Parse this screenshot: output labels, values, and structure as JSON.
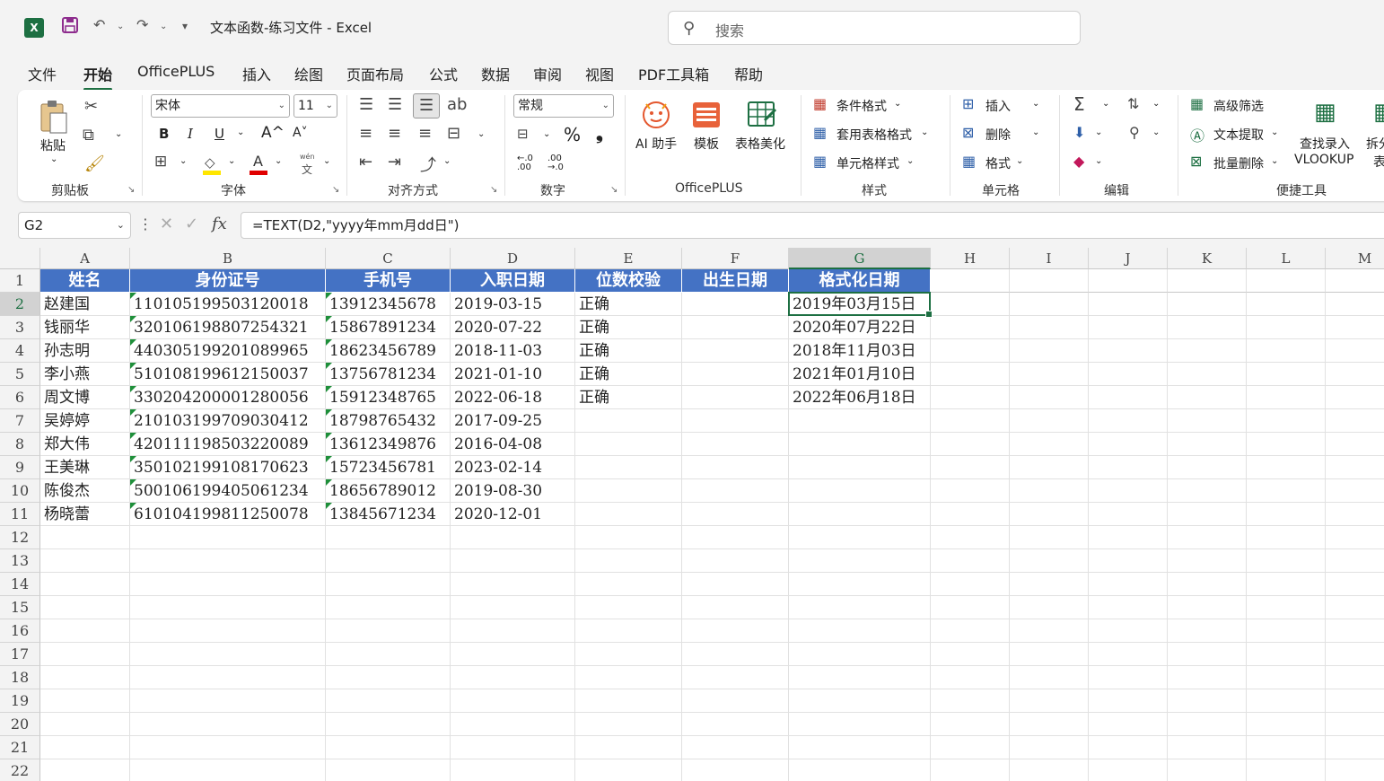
{
  "titlebar": {
    "app_icon": "excel-icon",
    "doc_title": "文本函数-练习文件  -  Excel",
    "search_placeholder": "搜索"
  },
  "tabs": [
    "文件",
    "开始",
    "OfficePLUS",
    "插入",
    "绘图",
    "页面布局",
    "公式",
    "数据",
    "审阅",
    "视图",
    "PDF工具箱",
    "帮助"
  ],
  "active_tab": "开始",
  "ribbon": {
    "clipboard": {
      "paste": "粘贴",
      "label": "剪贴板"
    },
    "font": {
      "name": "宋体",
      "size": "11",
      "label": "字体",
      "bold": "B",
      "italic": "I",
      "underline": "U",
      "grow": "A^",
      "shrink": "A˅",
      "wen": "wén",
      "wen2": "文"
    },
    "alignment": {
      "label": "对齐方式"
    },
    "number": {
      "format": "常规",
      "label": "数字",
      "percent": "%",
      "comma": "❟",
      "inc_dec": "←.0\n.00",
      "dec_dec": ".00\n→.0"
    },
    "officeplus": {
      "ai": "AI 助手",
      "template": "模板",
      "beautify": "表格美化",
      "label": "OfficePLUS"
    },
    "styles": {
      "conditional": "条件格式",
      "table_format": "套用表格格式",
      "cell_styles": "单元格样式",
      "label": "样式"
    },
    "cells": {
      "insert": "插入",
      "delete": "删除",
      "format": "格式",
      "label": "单元格"
    },
    "editing": {
      "label": "编辑"
    },
    "tools": {
      "advanced_filter": "高级筛选",
      "text_extract": "文本提取",
      "batch_delete": "批量删除",
      "lookup_line1": "查找录入",
      "lookup_line2": "VLOOKUP",
      "split1": "拆分",
      "split2": "表",
      "label": "便捷工具"
    }
  },
  "formula_bar": {
    "name_box": "G2",
    "formula": "=TEXT(D2,\"yyyy年mm月dd日\")"
  },
  "sheet": {
    "columns": [
      "A",
      "B",
      "C",
      "D",
      "E",
      "F",
      "G",
      "H",
      "I",
      "J",
      "K",
      "L",
      "M"
    ],
    "header_row": [
      "姓名",
      "身份证号",
      "手机号",
      "入职日期",
      "位数校验",
      "出生日期",
      "格式化日期"
    ],
    "rows": [
      [
        "赵建国",
        "110105199503120018",
        "13912345678",
        "2019-03-15",
        "正确",
        "",
        "2019年03月15日"
      ],
      [
        "钱丽华",
        "320106198807254321",
        "15867891234",
        "2020-07-22",
        "正确",
        "",
        "2020年07月22日"
      ],
      [
        "孙志明",
        "440305199201089965",
        "18623456789",
        "2018-11-03",
        "正确",
        "",
        "2018年11月03日"
      ],
      [
        "李小燕",
        "510108199612150037",
        "13756781234",
        "2021-01-10",
        "正确",
        "",
        "2021年01月10日"
      ],
      [
        "周文博",
        "330204200001280056",
        "15912348765",
        "2022-06-18",
        "正确",
        "",
        "2022年06月18日"
      ],
      [
        "吴婷婷",
        "210103199709030412",
        "18798765432",
        "2017-09-25",
        "",
        "",
        ""
      ],
      [
        "郑大伟",
        "420111198503220089",
        "13612349876",
        "2016-04-08",
        "",
        "",
        ""
      ],
      [
        "王美琳",
        "350102199108170623",
        "15723456781",
        "2023-02-14",
        "",
        "",
        ""
      ],
      [
        "陈俊杰",
        "500106199405061234",
        "18656789012",
        "2019-08-30",
        "",
        "",
        ""
      ],
      [
        "杨晓蕾",
        "610104199811250078",
        "13845671234",
        "2020-12-01",
        "",
        "",
        ""
      ]
    ],
    "row_numbers": [
      "1",
      "2",
      "3",
      "4",
      "5",
      "6",
      "7",
      "8",
      "9",
      "10",
      "11",
      "12",
      "13",
      "14",
      "15",
      "16",
      "17",
      "18",
      "19",
      "20",
      "21",
      "22"
    ],
    "selected_cell": "G2",
    "header_fill": "#4472c4",
    "selection_color": "#1d6f42"
  }
}
